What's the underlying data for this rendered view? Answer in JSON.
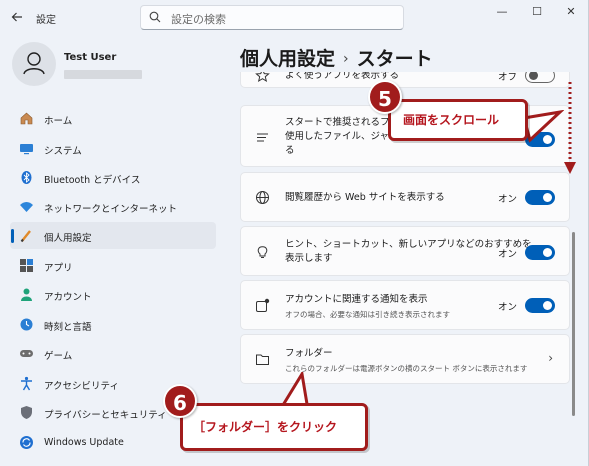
{
  "titlebar": {
    "back_icon": "back-arrow-icon",
    "app_title": "設定",
    "search_placeholder": "設定の検索",
    "minimize": "—",
    "maximize": "☐",
    "close": "✕"
  },
  "profile": {
    "name": "Test User"
  },
  "sidebar": {
    "items": [
      {
        "label": "ホーム",
        "icon": "home-icon"
      },
      {
        "label": "システム",
        "icon": "system-icon"
      },
      {
        "label": "Bluetooth とデバイス",
        "icon": "bluetooth-icon"
      },
      {
        "label": "ネットワークとインターネット",
        "icon": "network-icon"
      },
      {
        "label": "個人用設定",
        "icon": "personalization-icon",
        "active": true
      },
      {
        "label": "アプリ",
        "icon": "apps-icon"
      },
      {
        "label": "アカウント",
        "icon": "account-icon"
      },
      {
        "label": "時刻と言語",
        "icon": "time-language-icon"
      },
      {
        "label": "ゲーム",
        "icon": "gaming-icon"
      },
      {
        "label": "アクセシビリティ",
        "icon": "accessibility-icon"
      },
      {
        "label": "プライバシーとセキュリティ",
        "icon": "privacy-icon"
      },
      {
        "label": "Windows Update",
        "icon": "windows-update-icon"
      }
    ]
  },
  "header": {
    "breadcrumb_parent": "個人用設定",
    "breadcrumb_sep": "›",
    "breadcrumb_current": "スタート"
  },
  "settings": {
    "frequent_apps": {
      "title": "よく使うアプリを表示する",
      "state_label": "オフ",
      "on": false
    },
    "recommended": {
      "title_l1": "スタートで推奨されるファイ",
      "title_l2": "使用したファイル、ジャンプ",
      "title_l3": "る"
    },
    "browsing_history": {
      "title": "閲覧履歴から Web サイトを表示する",
      "state_label": "オン",
      "on": true
    },
    "tips": {
      "title_l1": "ヒント、ショートカット、新しいアプリなどのおすすめを",
      "title_l2": "表示します",
      "state_label": "オン",
      "on": true
    },
    "account_notifications": {
      "title": "アカウントに関連する通知を表示",
      "subtitle": "オフの場合、必要な通知は引き続き表示されます",
      "state_label": "オン",
      "on": true
    },
    "folders": {
      "title": "フォルダー",
      "subtitle": "これらのフォルダーは電源ボタンの横のスタート ボタンに表示されます"
    }
  },
  "annotations": {
    "step5": {
      "number": "5",
      "text": "画面をスクロール"
    },
    "step6": {
      "number": "6",
      "text": "［フォルダー］をクリック"
    },
    "accent_color": "#a11c1c"
  },
  "colors": {
    "accent": "#005fb8",
    "background": "#eef2f8",
    "card": "#fbfbfc"
  }
}
